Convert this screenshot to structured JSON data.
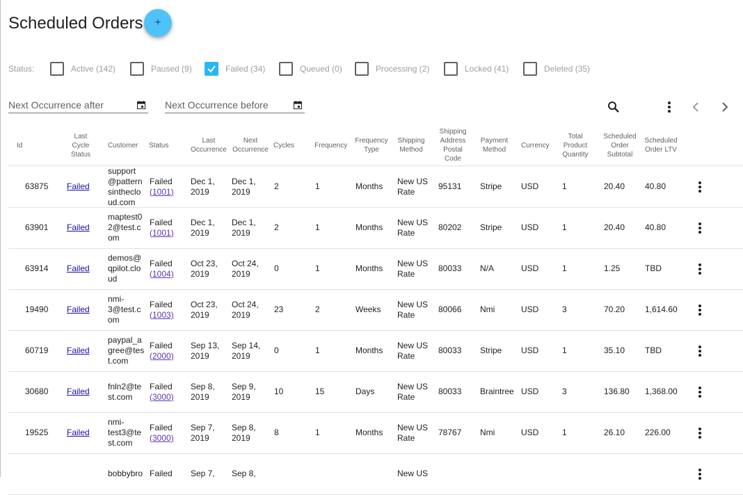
{
  "page": {
    "title": "Scheduled Orders",
    "add_label": "+"
  },
  "status_filter": {
    "label": "Status:",
    "options": [
      {
        "label": "Active (142)",
        "checked": false
      },
      {
        "label": "Paused (9)",
        "checked": false
      },
      {
        "label": "Failed (34)",
        "checked": true
      },
      {
        "label": "Queued (0)",
        "checked": false
      },
      {
        "label": "Processing (2)",
        "checked": false
      },
      {
        "label": "Locked (41)",
        "checked": false
      },
      {
        "label": "Deleted (35)",
        "checked": false
      }
    ]
  },
  "date_filters": {
    "after_placeholder": "Next Occurrence after",
    "before_placeholder": "Next Occurrence before"
  },
  "toolbar_icons": [
    "search-icon",
    "more-vert-icon",
    "chevron-left-icon",
    "chevron-right-icon"
  ],
  "colors": {
    "accent": "#29b6f6",
    "fab": "#4fc3f7",
    "link": "#1a0dab"
  },
  "table": {
    "columns": [
      "Id",
      "Last\nCycle\nStatus",
      "Customer",
      "Status",
      "Last\nOccurrence",
      "Next\nOccurrence",
      "Cycles",
      "Frequency",
      "Frequency\nType",
      "Shipping\nMethod",
      "Shipping\nAddress\nPostal\nCode",
      "Payment\nMethod",
      "Currency",
      "Total\nProduct\nQuantity",
      "Scheduled\nOrder\nSubtotal",
      "Scheduled\nOrder LTV"
    ],
    "rows": [
      {
        "id": "63875",
        "last_cycle": "Failed",
        "customer": "support\n@pattern\nsintheclo\nud.com",
        "status": "Failed",
        "status_code": "(1001)",
        "last_occ": "Dec 1,\n2019",
        "next_occ": "Dec 1,\n2019",
        "cycles": "2",
        "frequency": "1",
        "freq_type": "Months",
        "shipping": "New US\nRate",
        "postal": "95131",
        "payment": "Stripe",
        "currency": "USD",
        "qty": "1",
        "subtotal": "20.40",
        "ltv": "40.80"
      },
      {
        "id": "63901",
        "last_cycle": "Failed",
        "customer": "maptest0\n2@test.c\nom",
        "status": "Failed",
        "status_code": "(1001)",
        "last_occ": "Dec 1,\n2019",
        "next_occ": "Dec 1,\n2019",
        "cycles": "2",
        "frequency": "1",
        "freq_type": "Months",
        "shipping": "New US\nRate",
        "postal": "80202",
        "payment": "Stripe",
        "currency": "USD",
        "qty": "1",
        "subtotal": "20.40",
        "ltv": "40.80"
      },
      {
        "id": "63914",
        "last_cycle": "Failed",
        "customer": "demos@\nqpilot.clo\nud",
        "status": "Failed",
        "status_code": "(1004)",
        "last_occ": "Oct 23,\n2019",
        "next_occ": "Oct 24,\n2019",
        "cycles": "0",
        "frequency": "1",
        "freq_type": "Months",
        "shipping": "New US\nRate",
        "postal": "80033",
        "payment": "N/A",
        "currency": "USD",
        "qty": "1",
        "subtotal": "1.25",
        "ltv": "TBD"
      },
      {
        "id": "19490",
        "last_cycle": "Failed",
        "customer": "nmi-\n3@test.c\nom",
        "status": "Failed",
        "status_code": "(1003)",
        "last_occ": "Oct 23,\n2019",
        "next_occ": "Oct 24,\n2019",
        "cycles": "23",
        "frequency": "2",
        "freq_type": "Weeks",
        "shipping": "New US\nRate",
        "postal": "80066",
        "payment": "Nmi",
        "currency": "USD",
        "qty": "3",
        "subtotal": "70.20",
        "ltv": "1,614.60"
      },
      {
        "id": "60719",
        "last_cycle": "Failed",
        "customer": "paypal_a\ngree@tes\nt.com",
        "status": "Failed",
        "status_code": "(2000)",
        "last_occ": "Sep 13,\n2019",
        "next_occ": "Sep 14,\n2019",
        "cycles": "0",
        "frequency": "1",
        "freq_type": "Months",
        "shipping": "New US\nRate",
        "postal": "80033",
        "payment": "Stripe",
        "currency": "USD",
        "qty": "1",
        "subtotal": "35.10",
        "ltv": "TBD"
      },
      {
        "id": "30680",
        "last_cycle": "Failed",
        "customer": "fnln2@te\nst.com",
        "status": "Failed",
        "status_code": "(3000)",
        "last_occ": "Sep 8,\n2019",
        "next_occ": "Sep 9,\n2019",
        "cycles": "10",
        "frequency": "15",
        "freq_type": "Days",
        "shipping": "New US\nRate",
        "postal": "80033",
        "payment": "Braintree",
        "currency": "USD",
        "qty": "3",
        "subtotal": "136.80",
        "ltv": "1,368.00"
      },
      {
        "id": "19525",
        "last_cycle": "Failed",
        "customer": "nmi-\ntest3@te\nst.com",
        "status": "Failed",
        "status_code": "(3000)",
        "last_occ": "Sep 7,\n2019",
        "next_occ": "Sep 8,\n2019",
        "cycles": "8",
        "frequency": "1",
        "freq_type": "Months",
        "shipping": "New US\nRate",
        "postal": "78767",
        "payment": "Nmi",
        "currency": "USD",
        "qty": "1",
        "subtotal": "26.10",
        "ltv": "226.00"
      },
      {
        "id": "",
        "last_cycle": "",
        "customer": "bobbybro",
        "status": "Failed",
        "status_code": "",
        "last_occ": "Sep 7,",
        "next_occ": "Sep 8,",
        "cycles": "",
        "frequency": "",
        "freq_type": "",
        "shipping": "New US",
        "postal": "",
        "payment": "",
        "currency": "",
        "qty": "",
        "subtotal": "",
        "ltv": ""
      }
    ]
  }
}
